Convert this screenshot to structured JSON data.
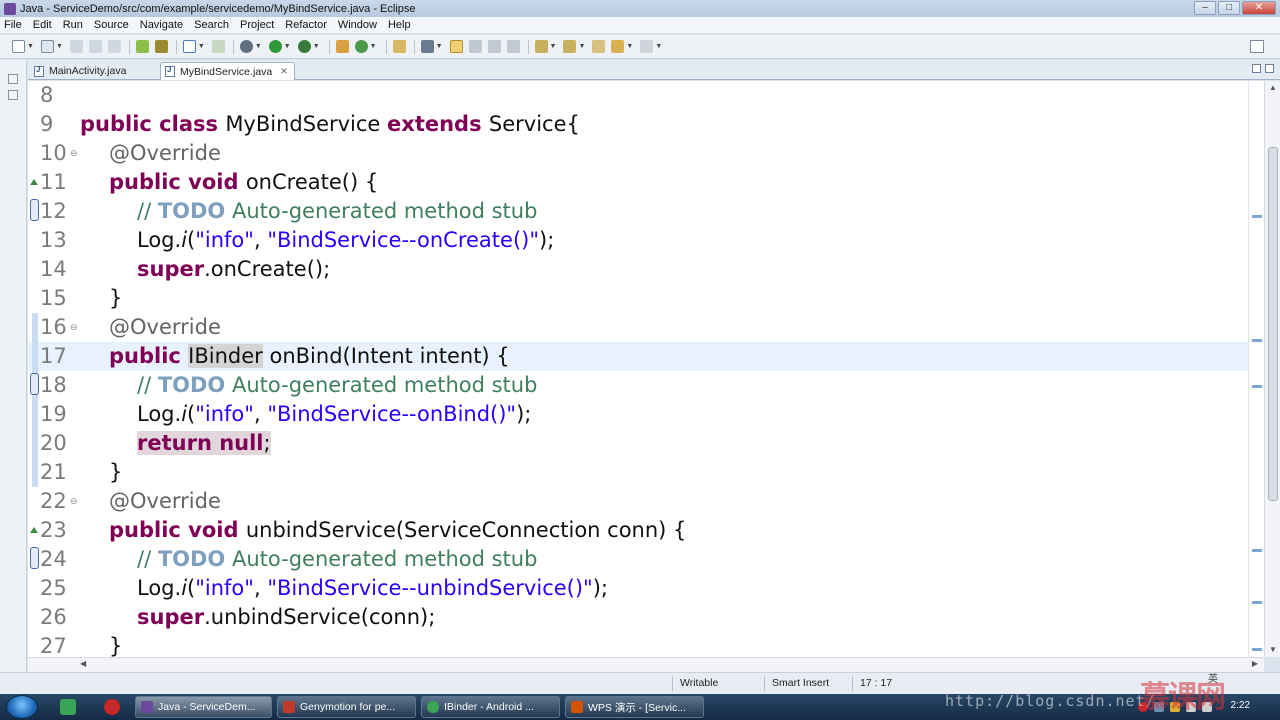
{
  "window": {
    "title": "Java - ServiceDemo/src/com/example/servicedemo/MyBindService.java - Eclipse",
    "buttons": [
      "minimize",
      "maximize",
      "close"
    ]
  },
  "menu": [
    "File",
    "Edit",
    "Run",
    "Source",
    "Navigate",
    "Search",
    "Project",
    "Refactor",
    "Window",
    "Help"
  ],
  "toolbar_icons": [
    "new-icon",
    "save-icon",
    "save-all-icon",
    "print-icon",
    "new-android-project-icon",
    "android-sdk-icon",
    "debug-icon",
    "run-icon",
    "external-tools-icon",
    "new-package-icon",
    "new-class-icon",
    "open-type-icon",
    "search-icon",
    "toggle-mark-occurrences-icon",
    "next-annotation-icon",
    "previous-annotation-icon",
    "back-icon",
    "forward-icon"
  ],
  "tabs": [
    {
      "label": "MainActivity.java",
      "active": false
    },
    {
      "label": "MyBindService.java",
      "active": true
    }
  ],
  "editor": {
    "current_line": 17,
    "lines": [
      {
        "num": "8",
        "code": ""
      },
      {
        "num": "9",
        "code": "public class MyBindService extends Service{"
      },
      {
        "num": "10",
        "code": "    @Override"
      },
      {
        "num": "11",
        "code": "    public void onCreate() {"
      },
      {
        "num": "12",
        "code": "        // TODO Auto-generated method stub"
      },
      {
        "num": "13",
        "code": "        Log.i(\"info\", \"BindService--onCreate()\");"
      },
      {
        "num": "14",
        "code": "        super.onCreate();"
      },
      {
        "num": "15",
        "code": "    }"
      },
      {
        "num": "16",
        "code": "    @Override"
      },
      {
        "num": "17",
        "code": "    public IBinder onBind(Intent intent) {"
      },
      {
        "num": "18",
        "code": "        // TODO Auto-generated method stub"
      },
      {
        "num": "19",
        "code": "        Log.i(\"info\", \"BindService--onBind()\");"
      },
      {
        "num": "20",
        "code": "        return null;"
      },
      {
        "num": "21",
        "code": "    }"
      },
      {
        "num": "22",
        "code": "    @Override"
      },
      {
        "num": "23",
        "code": "    public void unbindService(ServiceConnection conn) {"
      },
      {
        "num": "24",
        "code": "        // TODO Auto-generated method stub"
      },
      {
        "num": "25",
        "code": "        Log.i(\"info\", \"BindService--unbindService()\");"
      },
      {
        "num": "26",
        "code": "        super.unbindService(conn);"
      },
      {
        "num": "27",
        "code": "    }"
      }
    ]
  },
  "statusbar": {
    "writable": "Writable",
    "insert_mode": "Smart Insert",
    "position": "17 : 17"
  },
  "taskbar": {
    "tasks": [
      {
        "label": "Java - ServiceDem...",
        "active": true,
        "color": "#6b4aa0"
      },
      {
        "label": "Genymotion for pe...",
        "active": false,
        "color": "#c0392b"
      },
      {
        "label": "IBinder - Android ...",
        "active": false,
        "color": "#3aa655"
      },
      {
        "label": "WPS 演示 - [Servic...",
        "active": false,
        "color": "#d35400"
      }
    ],
    "clock": "2:22",
    "lang": "英"
  },
  "watermark": "http://blog.csdn.net/",
  "brand_mark": "慕课网"
}
